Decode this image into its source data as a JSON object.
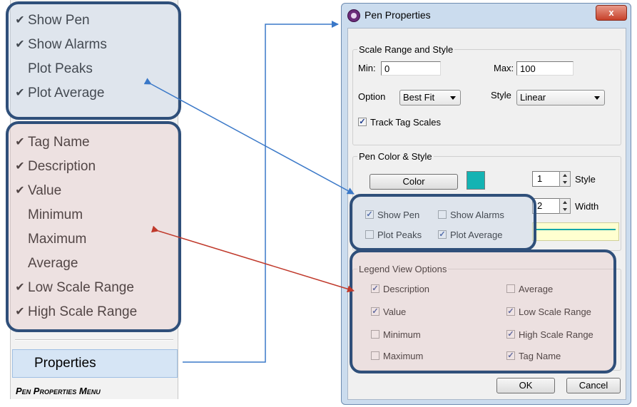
{
  "menu": {
    "pen_items": [
      {
        "label": "Show Pen",
        "checked": true
      },
      {
        "label": "Show Alarms",
        "checked": true
      },
      {
        "label": "Plot Peaks",
        "checked": false
      },
      {
        "label": "Plot Average",
        "checked": true
      }
    ],
    "legend_items": [
      {
        "label": "Tag Name",
        "checked": true
      },
      {
        "label": "Description",
        "checked": true
      },
      {
        "label": "Value",
        "checked": true
      },
      {
        "label": "Minimum",
        "checked": false
      },
      {
        "label": "Maximum",
        "checked": false
      },
      {
        "label": "Average",
        "checked": false
      },
      {
        "label": "Low Scale Range",
        "checked": true
      },
      {
        "label": "High Scale Range",
        "checked": true
      }
    ],
    "properties_label": "Properties",
    "check_glyph": "✔"
  },
  "caption": "Pen Properties Menu",
  "dialog": {
    "title": "Pen Properties",
    "close_glyph": "x",
    "scale": {
      "legend": "Scale Range and Style",
      "min_label": "Min:",
      "min_value": "0",
      "max_label": "Max:",
      "max_value": "100",
      "option_label": "Option",
      "option_value": "Best Fit",
      "style_label": "Style",
      "style_value": "Linear",
      "track_label": "Track Tag Scales",
      "track_checked": true
    },
    "pen": {
      "legend": "Pen Color & Style",
      "color_button": "Color",
      "color_value": "#14b3b3",
      "style_num": "1",
      "style_label": "Style",
      "width_num": "2",
      "width_label": "Width",
      "show_pen": "Show Pen",
      "show_alarms": "Show Alarms",
      "plot_peaks": "Plot Peaks",
      "plot_average": "Plot Average",
      "show_pen_checked": true,
      "show_alarms_checked": false,
      "plot_peaks_checked": false,
      "plot_average_checked": true
    },
    "legend_view": {
      "legend": "Legend View Options",
      "description": "Description",
      "value": "Value",
      "minimum": "Minimum",
      "maximum": "Maximum",
      "average": "Average",
      "low_scale": "Low Scale Range",
      "high_scale": "High Scale Range",
      "tag_name": "Tag Name",
      "checked": {
        "description": true,
        "value": true,
        "minimum": false,
        "maximum": false,
        "average": false,
        "low_scale": true,
        "high_scale": true,
        "tag_name": true
      }
    },
    "ok_button": "OK",
    "cancel_button": "Cancel"
  },
  "colors": {
    "highlight_border": "#2f4f7a",
    "pen_group_fill": "#e3e8f1",
    "legend_group_fill": "#f1e3e3",
    "arrow_blue": "#3a78c8",
    "arrow_red": "#c0392b",
    "pen_color": "#14b3b3"
  }
}
